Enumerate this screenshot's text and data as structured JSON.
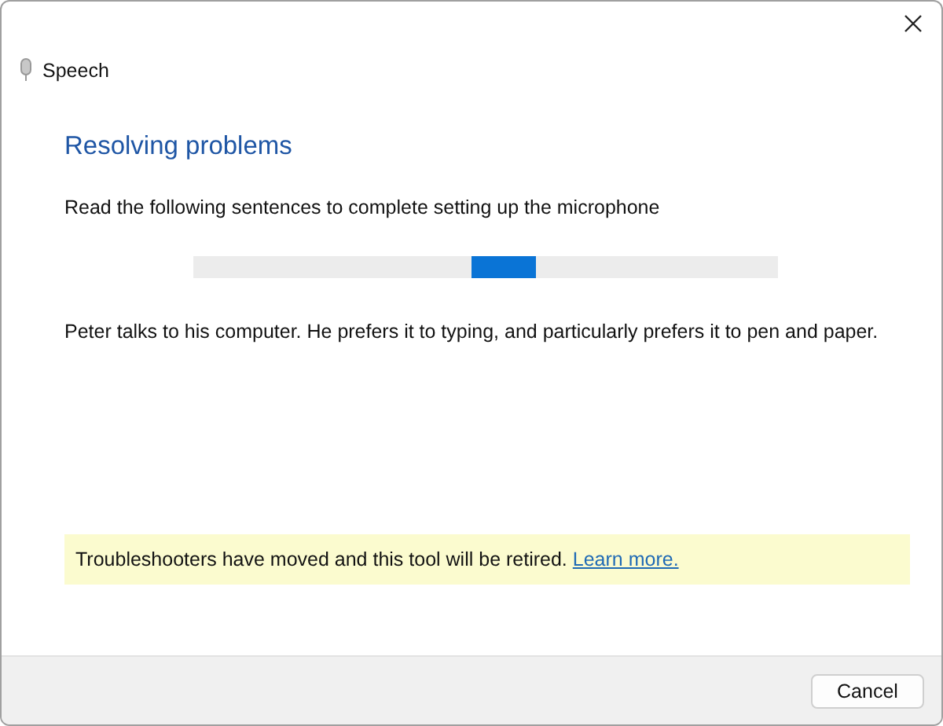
{
  "window": {
    "title": "Speech"
  },
  "heading": "Resolving problems",
  "instruction": "Read the following sentences to complete setting up the microphone",
  "progress": {
    "kind": "marquee"
  },
  "sentence": "Peter talks to his computer. He prefers it to typing, and particularly prefers it to pen and paper.",
  "notice": {
    "text": "Troubleshooters have moved and this tool will be retired.",
    "link": "Learn more."
  },
  "buttons": [
    "Cancel"
  ]
}
